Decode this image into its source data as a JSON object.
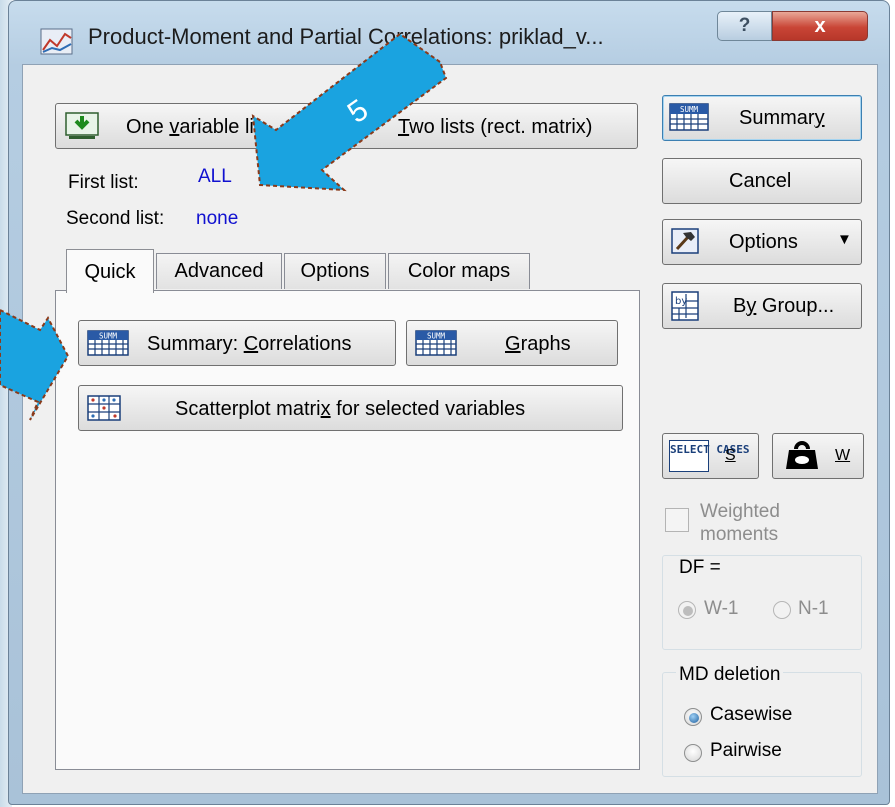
{
  "window": {
    "title": "Product-Moment and Partial Correlations: priklad_v...",
    "help_label": "?",
    "close_label": "x"
  },
  "variables": {
    "one_list": {
      "pre": "One ",
      "key": "v",
      "post": "ariable li"
    },
    "two_lists": {
      "key": "T",
      "post": "wo lists (rect. matrix)"
    },
    "first_list_label": "First list:",
    "first_list_value": "ALL",
    "second_list_label": "Second list:",
    "second_list_value": "none"
  },
  "tabs": [
    "Quick",
    "Advanced",
    "Options",
    "Color maps"
  ],
  "quick": {
    "summary_correlations": {
      "pre": "Summary:  ",
      "key": "C",
      "post": "orrelations"
    },
    "graphs": {
      "key": "G",
      "post": "raphs"
    },
    "scatterplot": {
      "pre": "Scatterplot matri",
      "key": "x",
      "post": " for selected variables"
    }
  },
  "side": {
    "summary": {
      "pre": "Summar",
      "key": "y"
    },
    "cancel": "Cancel",
    "options": "Options",
    "by_group": {
      "pre": "B",
      "key": "y",
      "post": " Group..."
    },
    "select_cases_icon_text": "SELECT CASES",
    "select_key": "S",
    "weights_key": "W",
    "weighted_moments": "Weighted moments",
    "df_label": "DF =",
    "df_options": [
      "W-1",
      "N-1"
    ],
    "md_deletion_label": "MD deletion",
    "md_options": [
      "Casewise",
      "Pairwise"
    ],
    "md_selected": "Casewise",
    "df_selected": "W-1"
  },
  "annotation": {
    "step_number": "5"
  },
  "colors": {
    "arrow_fill": "#1aa3e0",
    "arrow_outline": "#8a3a1a",
    "link_blue": "#1010d0"
  }
}
